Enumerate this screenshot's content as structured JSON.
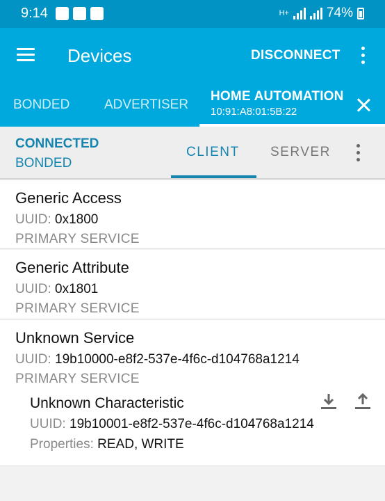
{
  "status_bar": {
    "time": "9:14",
    "network": "H+",
    "battery": "74%"
  },
  "app_bar": {
    "title": "Devices",
    "disconnect_label": "DISCONNECT"
  },
  "tabs": {
    "items": [
      "BONDED",
      "ADVERTISER"
    ],
    "active_name": "HOME AUTOMATION",
    "active_address": "10:91:A8:01:5B:22"
  },
  "connection": {
    "state": "CONNECTED",
    "bond_state": "BONDED",
    "client_tab": "CLIENT",
    "server_tab": "SERVER"
  },
  "labels": {
    "uuid": "UUID:",
    "properties": "Properties:"
  },
  "services": [
    {
      "name": "Generic Access",
      "uuid": "0x1800",
      "type": "PRIMARY SERVICE"
    },
    {
      "name": "Generic Attribute",
      "uuid": "0x1801",
      "type": "PRIMARY SERVICE"
    },
    {
      "name": "Unknown Service",
      "uuid": "19b10000-e8f2-537e-4f6c-d104768a1214",
      "type": "PRIMARY SERVICE"
    }
  ],
  "characteristic": {
    "name": "Unknown Characteristic",
    "uuid": "19b10001-e8f2-537e-4f6c-d104768a1214",
    "properties": "READ, WRITE",
    "actions": [
      "download-icon",
      "upload-icon"
    ]
  },
  "colors": {
    "status_bar": "#0093c4",
    "app_bar": "#00a9dd",
    "accent": "#1585b0"
  }
}
